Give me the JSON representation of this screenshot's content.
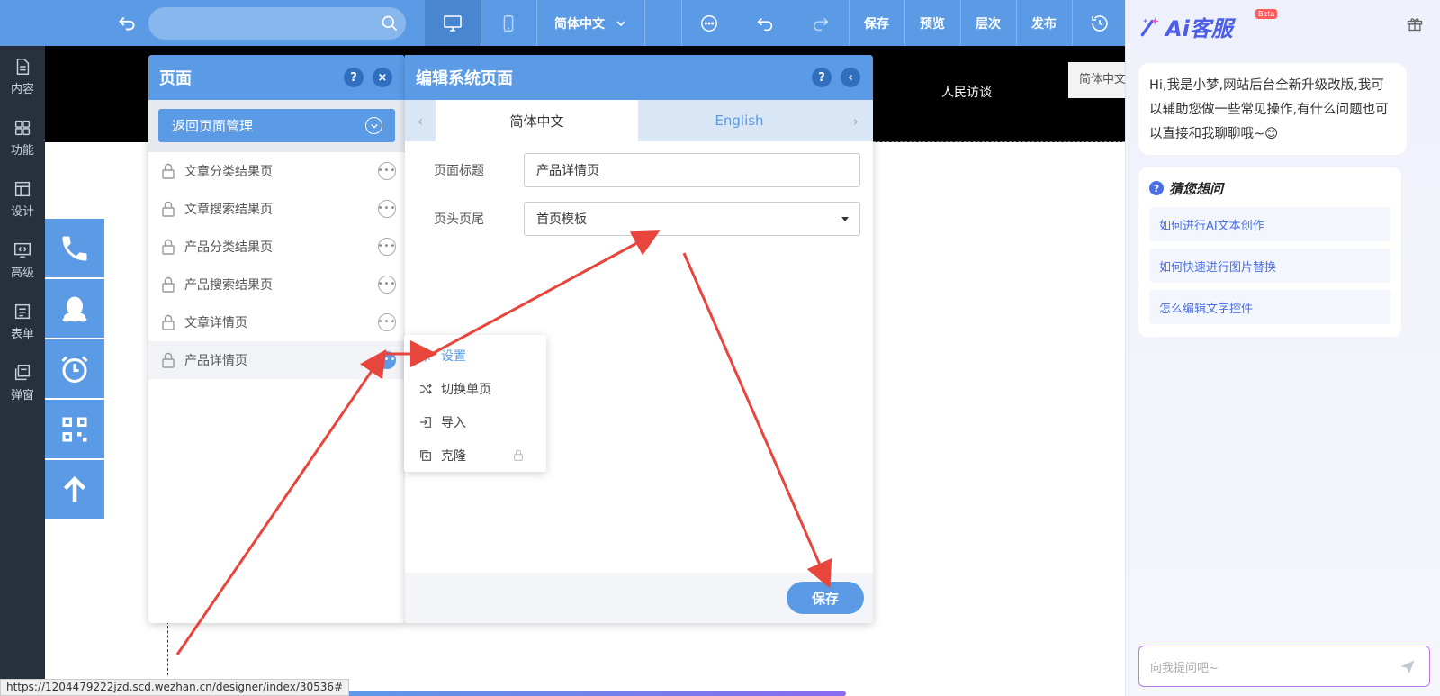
{
  "toolbar": {
    "language": "简体中文",
    "save": "保存",
    "preview": "预览",
    "layers": "层次",
    "publish": "发布"
  },
  "sidebar": {
    "items": [
      {
        "label": "内容",
        "icon": "document-icon"
      },
      {
        "label": "功能",
        "icon": "grid-icon"
      },
      {
        "label": "设计",
        "icon": "layout-icon"
      },
      {
        "label": "高级",
        "icon": "code-monitor-icon"
      },
      {
        "label": "表单",
        "icon": "form-icon"
      },
      {
        "label": "弹窗",
        "icon": "popup-icon"
      }
    ]
  },
  "canvas": {
    "banner_text": "人民访谈",
    "lang_chip": "简体中文",
    "status_url": "https://1204479222jzd.scd.wezhan.cn/designer/index/30536#"
  },
  "pages_panel": {
    "title": "页面",
    "help": "?",
    "close": "×",
    "back_button": "返回页面管理",
    "items": [
      {
        "label": "文章分类结果页"
      },
      {
        "label": "文章搜索结果页"
      },
      {
        "label": "产品分类结果页"
      },
      {
        "label": "产品搜索结果页"
      },
      {
        "label": "文章详情页"
      },
      {
        "label": "产品详情页"
      }
    ]
  },
  "edit_panel": {
    "title": "编辑系统页面",
    "help": "?",
    "collapse": "‹",
    "tabs": [
      "简体中文",
      "English"
    ],
    "fields": {
      "title_label": "页面标题",
      "title_value": "产品详情页",
      "header_label": "页头页尾",
      "header_value": "首页模板"
    },
    "save": "保存"
  },
  "context_menu": {
    "items": [
      {
        "label": "设置"
      },
      {
        "label": "切换单页"
      },
      {
        "label": "导入"
      },
      {
        "label": "克隆"
      }
    ]
  },
  "ai": {
    "logo": "Ai客服",
    "beta": "Beta",
    "greeting": "Hi,我是小梦,网站后台全新升级改版,我可以辅助您做一些常见操作,有什么问题也可以直接和我聊聊哦~😊",
    "suggest_title": "猜您想问",
    "questions": [
      "如何进行AI文本创作",
      "如何快速进行图片替换",
      "怎么编辑文字控件"
    ],
    "input_placeholder": "向我提问吧~"
  },
  "colors": {
    "primary": "#5b9be6",
    "sidebar": "#27303d",
    "arrow": "#e8453c",
    "ai_accent": "#4a6ee8"
  }
}
